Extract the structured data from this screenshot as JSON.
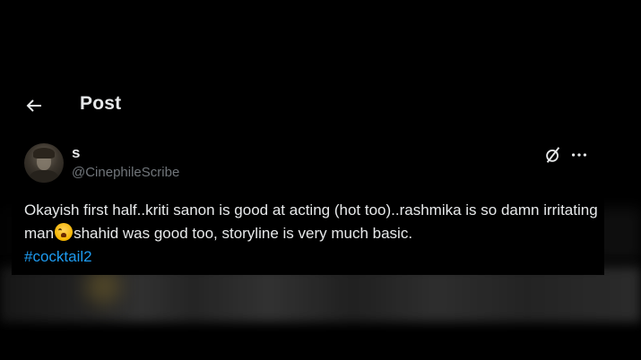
{
  "header": {
    "back_icon": "arrow-left-icon",
    "title": "Post"
  },
  "post": {
    "author": {
      "display_name": "s",
      "handle": "@CinephileScribe",
      "avatar": "avatar-photo"
    },
    "actions": {
      "grok_icon": "grok-slash-icon",
      "more_icon": "more-horizontal-icon"
    },
    "text_part1": "Okayish first half..kriti sanon is good at acting (hot too)..rashmika is so damn irritating man",
    "emoji": "loudly-crying-face-emoji",
    "text_part2": "shahid was good too, storyline is very much basic.",
    "hashtag": "#cocktail2"
  },
  "colors": {
    "background": "#000000",
    "primary_text": "#e7e9ea",
    "secondary_text": "#71767b",
    "link": "#1d9bf0"
  }
}
